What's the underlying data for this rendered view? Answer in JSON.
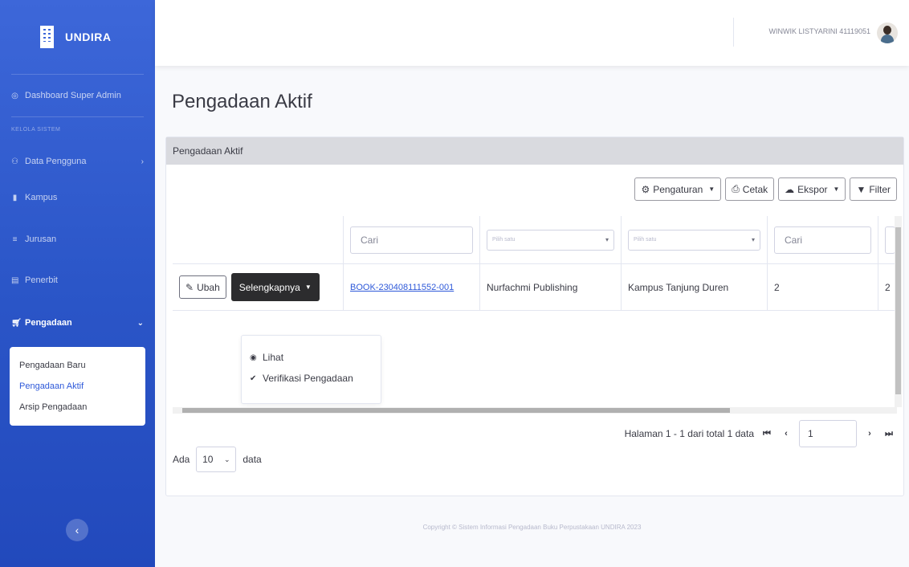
{
  "sidebar": {
    "brand": "UNDIRA",
    "items": [
      {
        "label": "Dashboard Super Admin",
        "icon": "dashboard-icon"
      },
      {
        "heading": "Kelola sistem"
      },
      {
        "label": "Data Pengguna",
        "icon": "users-icon"
      },
      {
        "label": "Kampus",
        "icon": "building-icon"
      },
      {
        "label": "Jurusan",
        "icon": "list-icon"
      },
      {
        "label": "Penerbit",
        "icon": "book-icon"
      },
      {
        "label": "Pengadaan",
        "icon": "cart-icon"
      }
    ],
    "submenu": [
      "Pengadaan Baru",
      "Pengadaan Aktif",
      "Arsip Pengadaan"
    ]
  },
  "topbar": {
    "user": "WINWIK LISTYARINI 41119051"
  },
  "page_title": "Pengadaan Aktif",
  "card_header": "Pengadaan Aktif",
  "toolbar": {
    "settings": "Pengaturan",
    "print": "Cetak",
    "export": "Ekspor",
    "filter": "Filter"
  },
  "filters": {
    "search1": "Cari",
    "select1": "Pilih satu",
    "select2": "Pilih satu",
    "search2": "Cari"
  },
  "row": {
    "edit": "Ubah",
    "more": "Selengkapnya",
    "code": "BOOK-230408111552-001",
    "publisher": "Nurfachmi Publishing",
    "campus": "Kampus Tanjung Duren",
    "qty": "2",
    "qty2": "2"
  },
  "dropdown": [
    "Lihat",
    "Verifikasi Pengadaan"
  ],
  "pager": {
    "info": "Halaman 1 - 1 dari total 1 data",
    "page": "1"
  },
  "perpage": {
    "prefix": "Ada",
    "value": "10",
    "suffix": "data"
  },
  "footer": "Copyright © Sistem Informasi Pengadaan Buku Perpustakaan UNDIRA 2023"
}
